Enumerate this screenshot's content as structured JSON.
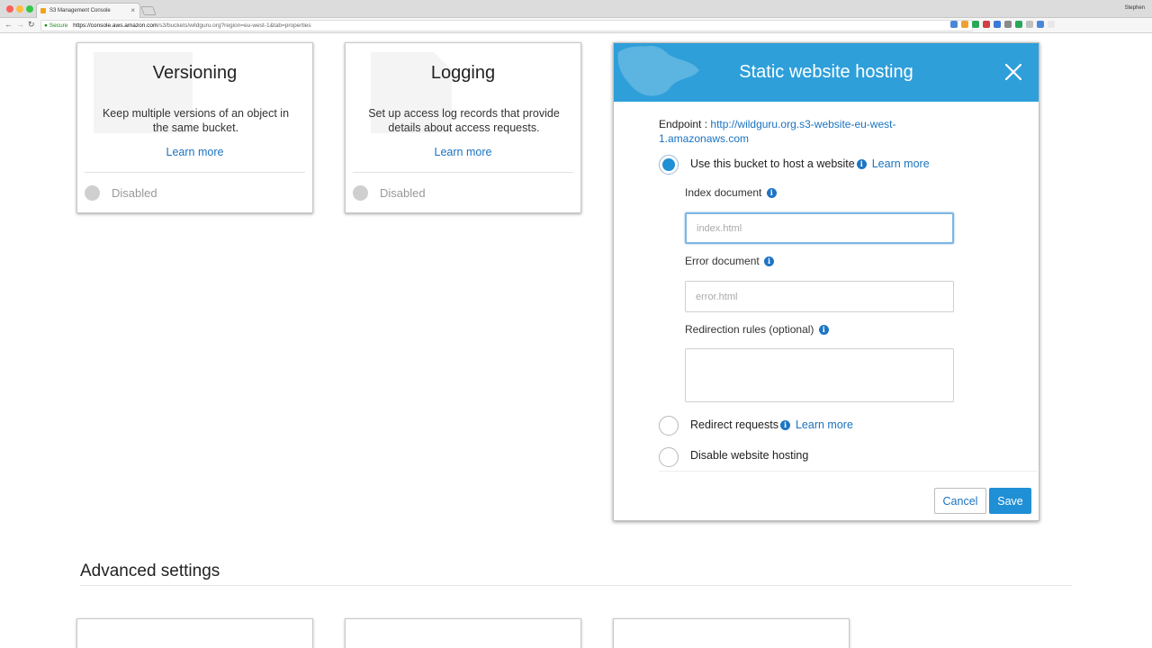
{
  "browser": {
    "tab_title": "S3 Management Console",
    "tab_close": "×",
    "profile_name": "Stephen",
    "secure_label": "Secure",
    "url_host": "https://console.aws.amazon.com",
    "url_path": "/s3/buckets/wildguru.org?region=eu-west-1&tab=properties",
    "back_glyph": "←",
    "forward_glyph": "→",
    "reload_glyph": "↻",
    "lock_glyph": "🔒",
    "extension_colors": [
      "#4b87d8",
      "#f0a030",
      "#2aa85a",
      "#d04040",
      "#3c78d8",
      "#8a8a8a",
      "#2aa85a",
      "#c0c0c0",
      "#4b87d8",
      "#e8e8e8"
    ]
  },
  "cards": [
    {
      "title": "Versioning",
      "description": "Keep multiple versions of an object in the same bucket.",
      "link": "Learn more",
      "status": "Disabled"
    },
    {
      "title": "Logging",
      "description": "Set up access log records that provide details about access requests.",
      "link": "Learn more",
      "status": "Disabled"
    }
  ],
  "modal": {
    "title": "Static website hosting",
    "close_icon": "close-icon",
    "endpoint_label": "Endpoint :",
    "endpoint_url": "http://wildguru.org.s3-website-eu-west-1.amazonaws.com",
    "options": [
      {
        "label": "Use this bucket to host a website",
        "learn_more": "Learn more",
        "selected": true
      },
      {
        "label": "Redirect requests",
        "learn_more": "Learn more",
        "selected": false
      },
      {
        "label": "Disable website hosting",
        "selected": false
      }
    ],
    "index_document": {
      "label": "Index document",
      "placeholder": "index.html"
    },
    "error_document": {
      "label": "Error document",
      "placeholder": "error.html"
    },
    "redirection_rules": {
      "label": "Redirection rules (optional)"
    },
    "info_glyph": "i",
    "cancel_label": "Cancel",
    "save_label": "Save"
  },
  "advanced": {
    "title": "Advanced settings"
  },
  "colors": {
    "accent": "#1f8fd6",
    "header": "#2e9fd9",
    "link": "#1a73c0"
  }
}
